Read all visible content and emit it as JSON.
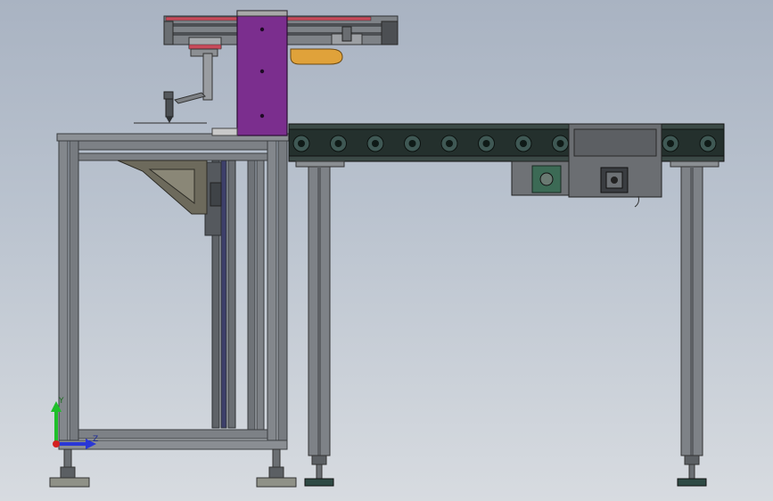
{
  "viewport": {
    "background_top": "#a9b3c2",
    "background_bottom": "#d7dbe0"
  },
  "model": {
    "frame_color": "#7d8186",
    "conveyor_color": "#24302d",
    "carriage_color": "#7b2e8e",
    "cable_chain_color": "#e0a23a",
    "accent_red": "#c84a5a"
  },
  "triad": {
    "axis_y_label": "Y",
    "axis_z_label": "Z",
    "y_color": "#1fbf2a",
    "z_color": "#2a37d6",
    "x_color": "#d42020"
  },
  "conveyor": {
    "roller_count": 12
  }
}
